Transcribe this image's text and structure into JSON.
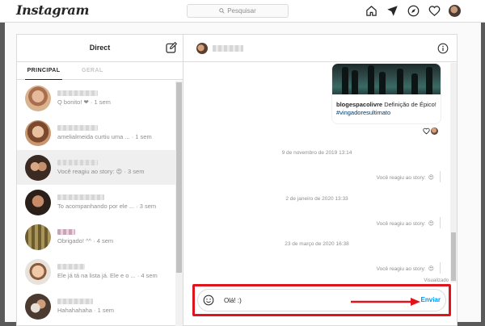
{
  "topnav": {
    "logo": "Instagram",
    "search_placeholder": "Pesquisar",
    "icons": [
      "home-icon",
      "direct-icon",
      "explore-icon",
      "heart-icon",
      "profile-avatar"
    ]
  },
  "direct": {
    "title": "Direct",
    "tabs": [
      {
        "label": "PRINCIPAL",
        "active": true
      },
      {
        "label": "GERAL",
        "active": false
      }
    ],
    "threads": [
      {
        "preview": "Q bonito! ❤ · 1 sem",
        "selected": false
      },
      {
        "preview": "amelialmeida curtiu uma ... · 1 sem",
        "selected": false
      },
      {
        "preview": "Você reagiu ao story: 😍 · 3 sem",
        "selected": true
      },
      {
        "preview": "To acompanhando por ele ... · 3 sem",
        "selected": false
      },
      {
        "preview": "Obrigado! ^^ · 4 sem",
        "selected": false
      },
      {
        "preview": "Ele já tá na lista já. Ele e o ... · 4 sem",
        "selected": false
      },
      {
        "preview": "Hahahahaha · 1 sem",
        "selected": false
      }
    ]
  },
  "chat": {
    "card": {
      "user": "blogespacolivre",
      "text": "Definição de Épico!",
      "tag": "#vingadoresultimato"
    },
    "entries": [
      {
        "timestamp": "9 de novembro de 2019 13:14",
        "reaction": "Você reagiu ao story:",
        "emoji": "😍"
      },
      {
        "timestamp": "2 de janeiro de 2020 13:33",
        "reaction": "Você reagiu ao story:",
        "emoji": "😍"
      },
      {
        "timestamp": "23 de março de 2020 16:38",
        "reaction": "Você reagiu ao story:",
        "emoji": "😍"
      }
    ],
    "seen": "Visualizado"
  },
  "composer": {
    "value": "Olá! :)",
    "send_label": "Enviar"
  },
  "colors": {
    "accent": "#0095f6",
    "highlight": "#e0141c"
  }
}
